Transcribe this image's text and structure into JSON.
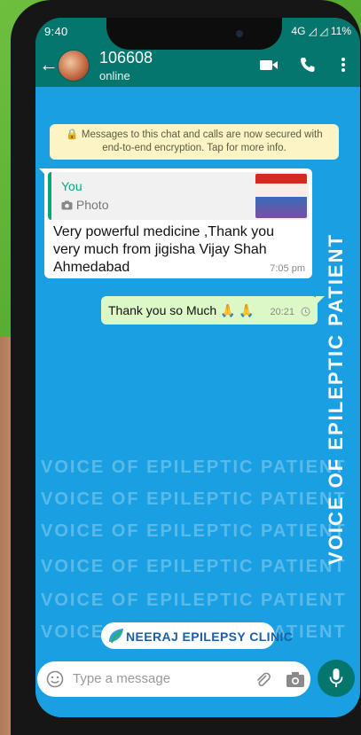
{
  "status_bar": {
    "time": "9:40",
    "indicators": "◎ Y ◎ •",
    "signal": "4G ◿ ◿ 11%"
  },
  "header": {
    "contact_name": "106608",
    "contact_status": "online",
    "back_icon": "arrow-left-icon",
    "actions": [
      "video-call-icon",
      "voice-call-icon",
      "menu-icon"
    ]
  },
  "encryption_notice": "🔒 Messages to this chat and calls are now secured with end-to-end encryption. Tap for more info.",
  "messages": [
    {
      "direction": "in",
      "reply_to": {
        "author": "You",
        "type": "Photo"
      },
      "text": "Very powerful medicine ,Thank you very much from jigisha Vijay Shah Ahmedabad",
      "time": "7:05 pm"
    },
    {
      "direction": "out",
      "text": "Thank you so Much 🙏 🙏",
      "time": "20:21",
      "status_icon": "clock-icon"
    }
  ],
  "watermark": {
    "repeated_text": "VOICE OF EPILEPTIC PATIENT",
    "vertical_text": "VOICE OF EPILEPTIC PATIENT",
    "logo_text": "NEERAJ EPILEPSY CLINIC"
  },
  "composer": {
    "placeholder": "Type a message",
    "icons": [
      "emoji-icon",
      "attach-icon",
      "camera-icon",
      "mic-icon"
    ]
  },
  "colors": {
    "header": "#04766d",
    "chat_background": "#1aa0e2",
    "outgoing_bubble": "#dcf8c6",
    "incoming_bubble": "#ffffff",
    "notice": "#fdf4c5",
    "frame_background": "#4ea62b"
  }
}
